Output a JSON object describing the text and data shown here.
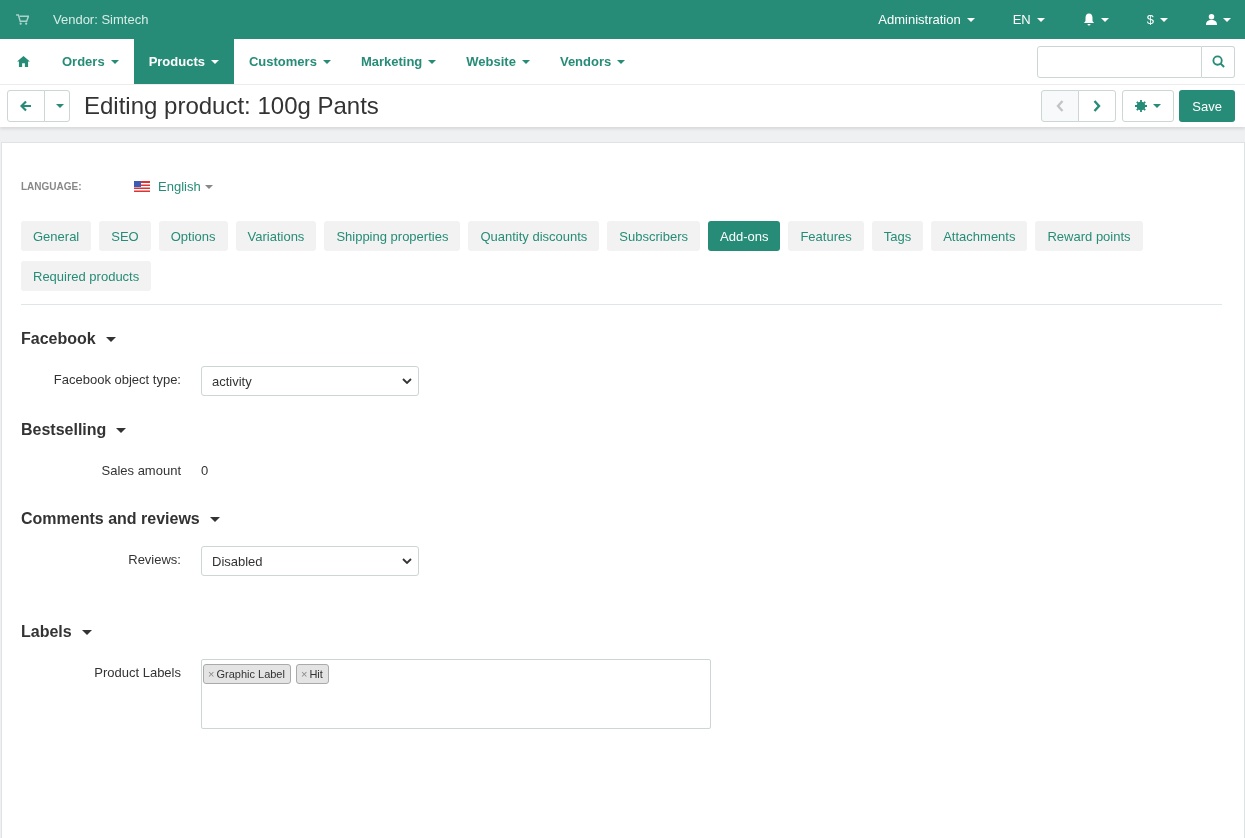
{
  "topbar": {
    "vendor": "Vendor: Simtech",
    "menus": [
      {
        "kind": "text",
        "label": "Administration"
      },
      {
        "kind": "text",
        "label": "EN"
      },
      {
        "kind": "bell"
      },
      {
        "kind": "text",
        "label": "$"
      },
      {
        "kind": "user"
      }
    ]
  },
  "nav": {
    "items": [
      {
        "label": "Orders",
        "selected": false
      },
      {
        "label": "Products",
        "selected": true
      },
      {
        "label": "Customers",
        "selected": false
      },
      {
        "label": "Marketing",
        "selected": false
      },
      {
        "label": "Website",
        "selected": false
      },
      {
        "label": "Vendors",
        "selected": false
      }
    ]
  },
  "toolbar": {
    "title": "Editing product: 100g Pants",
    "prev_disabled": true,
    "next_disabled": false,
    "save": "Save"
  },
  "language": {
    "label": "LANGUAGE:",
    "value": "English"
  },
  "tabs": [
    {
      "label": "General",
      "selected": false
    },
    {
      "label": "SEO",
      "selected": false
    },
    {
      "label": "Options",
      "selected": false
    },
    {
      "label": "Variations",
      "selected": false
    },
    {
      "label": "Shipping properties",
      "selected": false
    },
    {
      "label": "Quantity discounts",
      "selected": false
    },
    {
      "label": "Subscribers",
      "selected": false
    },
    {
      "label": "Add-ons",
      "selected": true
    },
    {
      "label": "Features",
      "selected": false
    },
    {
      "label": "Tags",
      "selected": false
    },
    {
      "label": "Attachments",
      "selected": false
    },
    {
      "label": "Reward points",
      "selected": false
    },
    {
      "label": "Required products",
      "selected": false
    }
  ],
  "sections": [
    {
      "title": "Facebook",
      "fields": [
        {
          "kind": "select",
          "label": "Facebook object type:",
          "value": "activity"
        }
      ]
    },
    {
      "title": "Bestselling",
      "fields": [
        {
          "kind": "text",
          "label": "Sales amount",
          "value": "0"
        }
      ]
    },
    {
      "title": "Comments and reviews",
      "fields": [
        {
          "kind": "select",
          "label": "Reviews:",
          "value": "Disabled"
        }
      ]
    },
    {
      "title": "Labels",
      "fields": [
        {
          "kind": "tags",
          "label": "Product Labels",
          "tags": [
            {
              "remove": "×",
              "label": "Graphic Label"
            },
            {
              "remove": "×",
              "label": "Hit"
            }
          ]
        }
      ]
    }
  ]
}
